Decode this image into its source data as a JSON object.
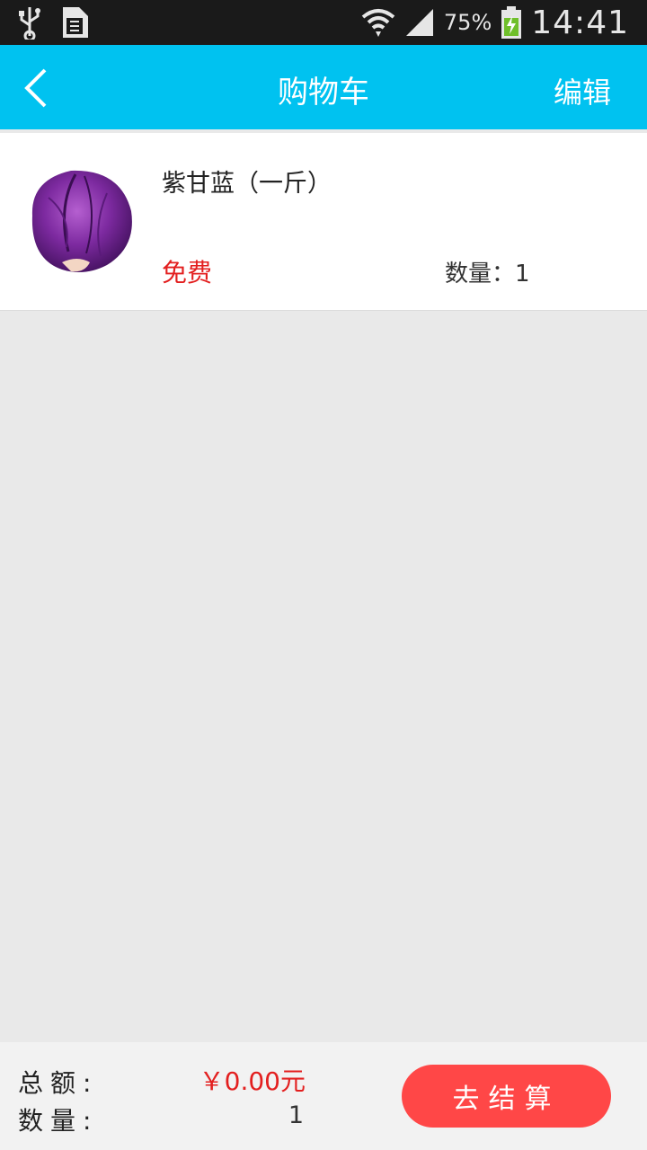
{
  "status_bar": {
    "battery_percent": "75%",
    "time": "14:41",
    "icons": [
      "usb-icon",
      "sim-icon",
      "wifi-icon",
      "signal-icon",
      "battery-charging-icon"
    ]
  },
  "app_bar": {
    "title": "购物车",
    "edit_label": "编辑",
    "back_icon": "chevron-left-icon"
  },
  "cart": {
    "items": [
      {
        "name": "紫甘蓝（一斤）",
        "price": "免费",
        "quantity": "数量：1",
        "image": "purple-cabbage"
      }
    ]
  },
  "footer": {
    "total_label": "总额:",
    "total_value": "￥0.00元",
    "quantity_label": "数量:",
    "quantity_value": "1",
    "checkout_label": "去结算"
  },
  "colors": {
    "app_bar": "#00c2f0",
    "price_red": "#e31f1f",
    "checkout_button": "#ff4747",
    "background": "#e9e9e9"
  }
}
